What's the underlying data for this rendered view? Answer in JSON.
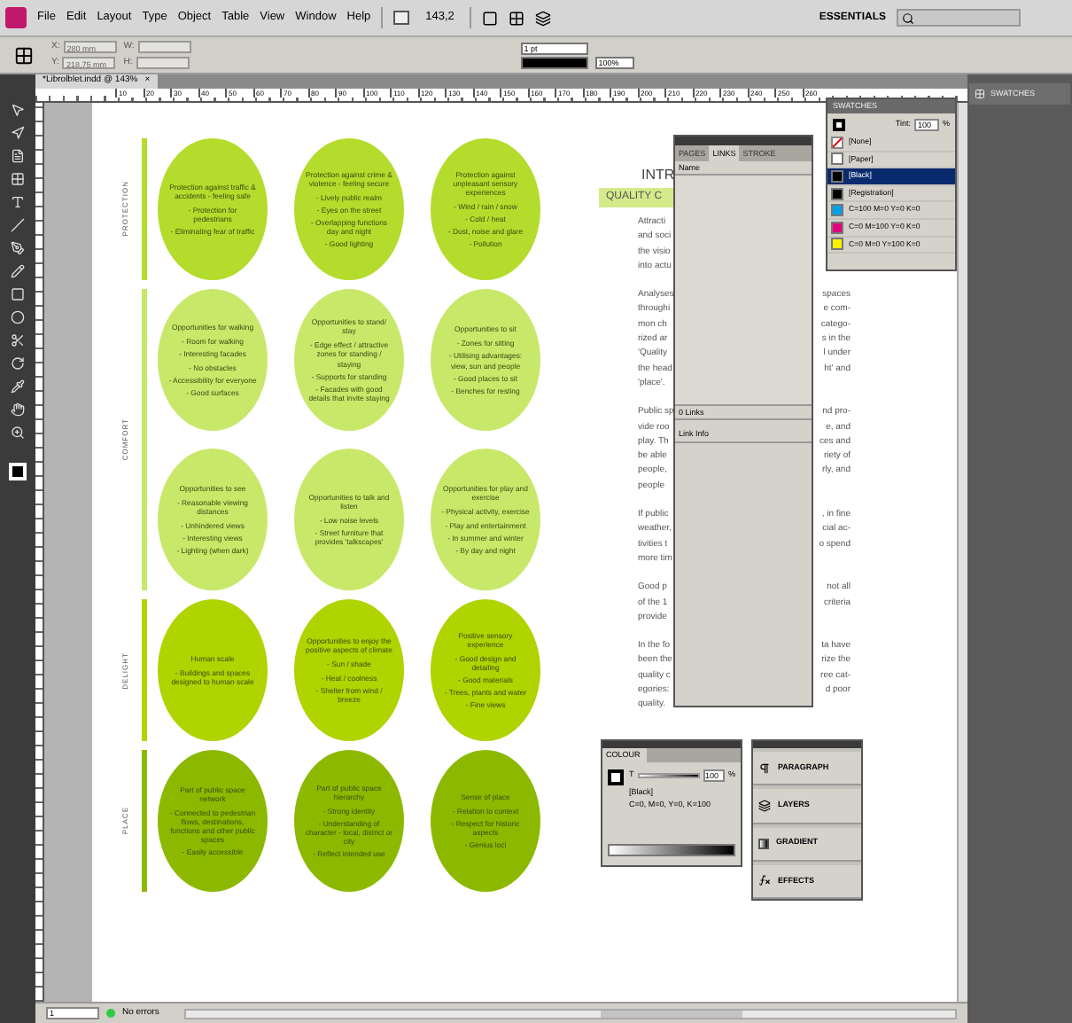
{
  "menu_bar": {
    "items": [
      "File",
      "Edit",
      "Layout",
      "Type",
      "Object",
      "Table",
      "View",
      "Window",
      "Help"
    ],
    "zoom": "143,2",
    "workspace": "ESSENTIALS"
  },
  "control_bar": {
    "fields": [
      {
        "label": "X:",
        "value": "280 mm"
      },
      {
        "label": "Y:",
        "value": "218,75 mm"
      },
      {
        "label": "W:"
      },
      {
        "label": "H:"
      }
    ],
    "stroke_weight": "1 pt",
    "opacity": "100%"
  },
  "document_tab": {
    "title": "*Librolblet.indd @ 143%",
    "close": "×"
  },
  "ruler_marks": [
    "10",
    "20",
    "30",
    "40",
    "50",
    "60",
    "70",
    "80",
    "90",
    "100",
    "110",
    "120",
    "130",
    "140",
    "150",
    "160",
    "170",
    "180",
    "190",
    "200",
    "210",
    "220",
    "230",
    "240",
    "250",
    "260"
  ],
  "categories": [
    {
      "label": "PROTECTION",
      "color": "#b4dc2c",
      "circles": [
        {
          "title": "Protection against traffic & accidents - feeling safe",
          "points": [
            "- Protection for pedestrians",
            "- Eliminating fear of traffic"
          ]
        },
        {
          "title": "Protection against crime & violence - feeling secure",
          "points": [
            "- Lively public realm",
            "- Eyes on the street",
            "- Overlapping functions day and night",
            "- Good lighting"
          ]
        },
        {
          "title": "Protection against unpleasant sensory experiences",
          "points": [
            "- Wind / rain / snow",
            "- Cold / heat",
            "- Dust, noise and glare",
            "- Pollution"
          ]
        }
      ]
    },
    {
      "label": "COMFORT",
      "color": "#c8e86a",
      "circles": [
        {
          "title": "Opportunities for walking",
          "points": [
            "- Room for walking",
            "- Interesting facades",
            "- No obstacles",
            "- Accessibility for everyone",
            "- Good surfaces"
          ]
        },
        {
          "title": "Opportunities to stand/ stay",
          "points": [
            "- Edge effect / attractive zones for standing / staying",
            "- Supports for standing",
            "- Facades with good details that invite staying"
          ]
        },
        {
          "title": "Opportunities to sit",
          "points": [
            "- Zones for sitting",
            "- Utilising advantages: view, sun and people",
            "- Good places to sit",
            "- Benches for resting"
          ]
        },
        {
          "title": "Opportunities to see",
          "points": [
            "- Reasonable viewing distances",
            "- Unhindered views",
            "- Interesting views",
            "- Lighting (when dark)"
          ]
        },
        {
          "title": "Opportunities to talk and listen",
          "points": [
            "- Low noise levels",
            "- Street furniture that provides 'talkscapes'"
          ]
        },
        {
          "title": "Opportunities for play and exercise",
          "points": [
            "- Physical activity, exercise",
            "- Play and entertainment",
            "- In summer and winter",
            "- By day and night"
          ]
        }
      ]
    },
    {
      "label": "DELIGHT",
      "color": "#afd400",
      "circles": [
        {
          "title": "Human scale",
          "points": [
            "- Buildings and spaces designed to human scale"
          ]
        },
        {
          "title": "Opportunities to enjoy the positive aspects of climate",
          "points": [
            "- Sun / shade",
            "- Heat / coolness",
            "- Shelter from wind / breeze"
          ]
        },
        {
          "title": "Positive sensory experience",
          "points": [
            "- Good design and detailing",
            "- Good materials",
            "- Trees, plants and water",
            "- Fine views"
          ]
        }
      ]
    },
    {
      "label": "PLACE",
      "color": "#8cb900",
      "circles": [
        {
          "title": "Part of public space network",
          "points": [
            "- Connected to pedestrian flows, destinations, functions and other public spaces",
            "- Easily accessible"
          ]
        },
        {
          "title": "Part of public space hierarchy",
          "points": [
            "- Strong identity",
            "- Understanding of character - local, district or city",
            "- Reflect intended use"
          ]
        },
        {
          "title": "Sense of place",
          "points": [
            "- Relation to context",
            "- Respect for historic aspects",
            "- Genius loci"
          ]
        }
      ]
    }
  ],
  "article": {
    "heading": "INTR",
    "band": "QUALITY C",
    "paragraphs": [
      [
        {
          "left": "Attracti"
        },
        {
          "left": "and soci"
        },
        {
          "left": "the visio"
        },
        {
          "left": "into actu"
        }
      ],
      [
        {
          "left": "Analyses",
          "right": "spaces"
        },
        {
          "left": "throughi",
          "right": "e com-"
        },
        {
          "left": "mon ch",
          "right": "catego-"
        },
        {
          "left": "rized ar",
          "right": "s in the"
        },
        {
          "left": "'Quality",
          "right": "l under"
        },
        {
          "left": "the head",
          "right": "ht' and"
        },
        {
          "left": "'place'."
        }
      ],
      [
        {
          "left": "Public sp",
          "right": "nd pro-"
        },
        {
          "left": "vide roo",
          "right": "e, and"
        },
        {
          "left": "play. Th",
          "right": "ces and"
        },
        {
          "left": "be able",
          "right": "riety of"
        },
        {
          "left": "people,",
          "right": "rly, and"
        },
        {
          "left": "people"
        }
      ],
      [
        {
          "left": "If public",
          "right": ", in fine"
        },
        {
          "left": "weather,",
          "right": "cial ac-"
        },
        {
          "left": "tivities t",
          "right": "o spend"
        },
        {
          "left": "more tim"
        }
      ],
      [
        {
          "left": "Good p",
          "right": "not all"
        },
        {
          "left": "of the 1",
          "right": "criteria"
        },
        {
          "left": "provide"
        }
      ],
      [
        {
          "left": "In the fo",
          "right": "ta have"
        },
        {
          "left": "been the",
          "right": "rize the"
        },
        {
          "left": "quality c",
          "right": "ree cat-"
        },
        {
          "left": "egories:",
          "right": "d poor"
        },
        {
          "left": "quality."
        }
      ]
    ]
  },
  "links_panel": {
    "tabs": [
      {
        "label": "PAGES",
        "selected": false
      },
      {
        "label": "LINKS",
        "selected": true
      },
      {
        "label": "STROKE",
        "selected": false
      }
    ],
    "name_column": "Name",
    "footer": "0 Links",
    "link_info": "Link Info"
  },
  "swatches_panel": {
    "title": "SWATCHES",
    "tint_label": "Tint:",
    "tint": "100",
    "percent": "%",
    "swatches": [
      {
        "name": "[None]",
        "kind": "none",
        "selected": false
      },
      {
        "name": "[Paper]",
        "kind": "color",
        "color": "#ffffff",
        "selected": false
      },
      {
        "name": "[Black]",
        "kind": "color",
        "color": "#000000",
        "selected": true
      },
      {
        "name": "[Registration]",
        "kind": "color",
        "color": "#000000",
        "selected": false
      },
      {
        "name": "C=100 M=0 Y=0 K=0",
        "kind": "color",
        "color": "#00a0e9",
        "selected": false
      },
      {
        "name": "C=0 M=100 Y=0 K=0",
        "kind": "color",
        "color": "#e4007f",
        "selected": false
      },
      {
        "name": "C=0 M=0 Y=100 K=0",
        "kind": "color",
        "color": "#fff000",
        "selected": false
      }
    ]
  },
  "collapsed_panel": {
    "label": "SWATCHES"
  },
  "colour_panel": {
    "title": "COLOUR",
    "tint_label": "T",
    "level": 1,
    "value": "100",
    "percent": "%",
    "swatch": "[Black]",
    "values": "C=0, M=0, Y=0, K=100"
  },
  "panel_dock": [
    {
      "label": "PARAGRAPH",
      "kind": "paragraph"
    },
    {
      "label": "LAYERS",
      "kind": "layers"
    },
    {
      "label": "GRADIENT",
      "kind": "gradient"
    },
    {
      "label": "EFFECTS",
      "kind": "effects"
    }
  ],
  "status_bar": {
    "page": "1",
    "preflight": "No errors"
  }
}
